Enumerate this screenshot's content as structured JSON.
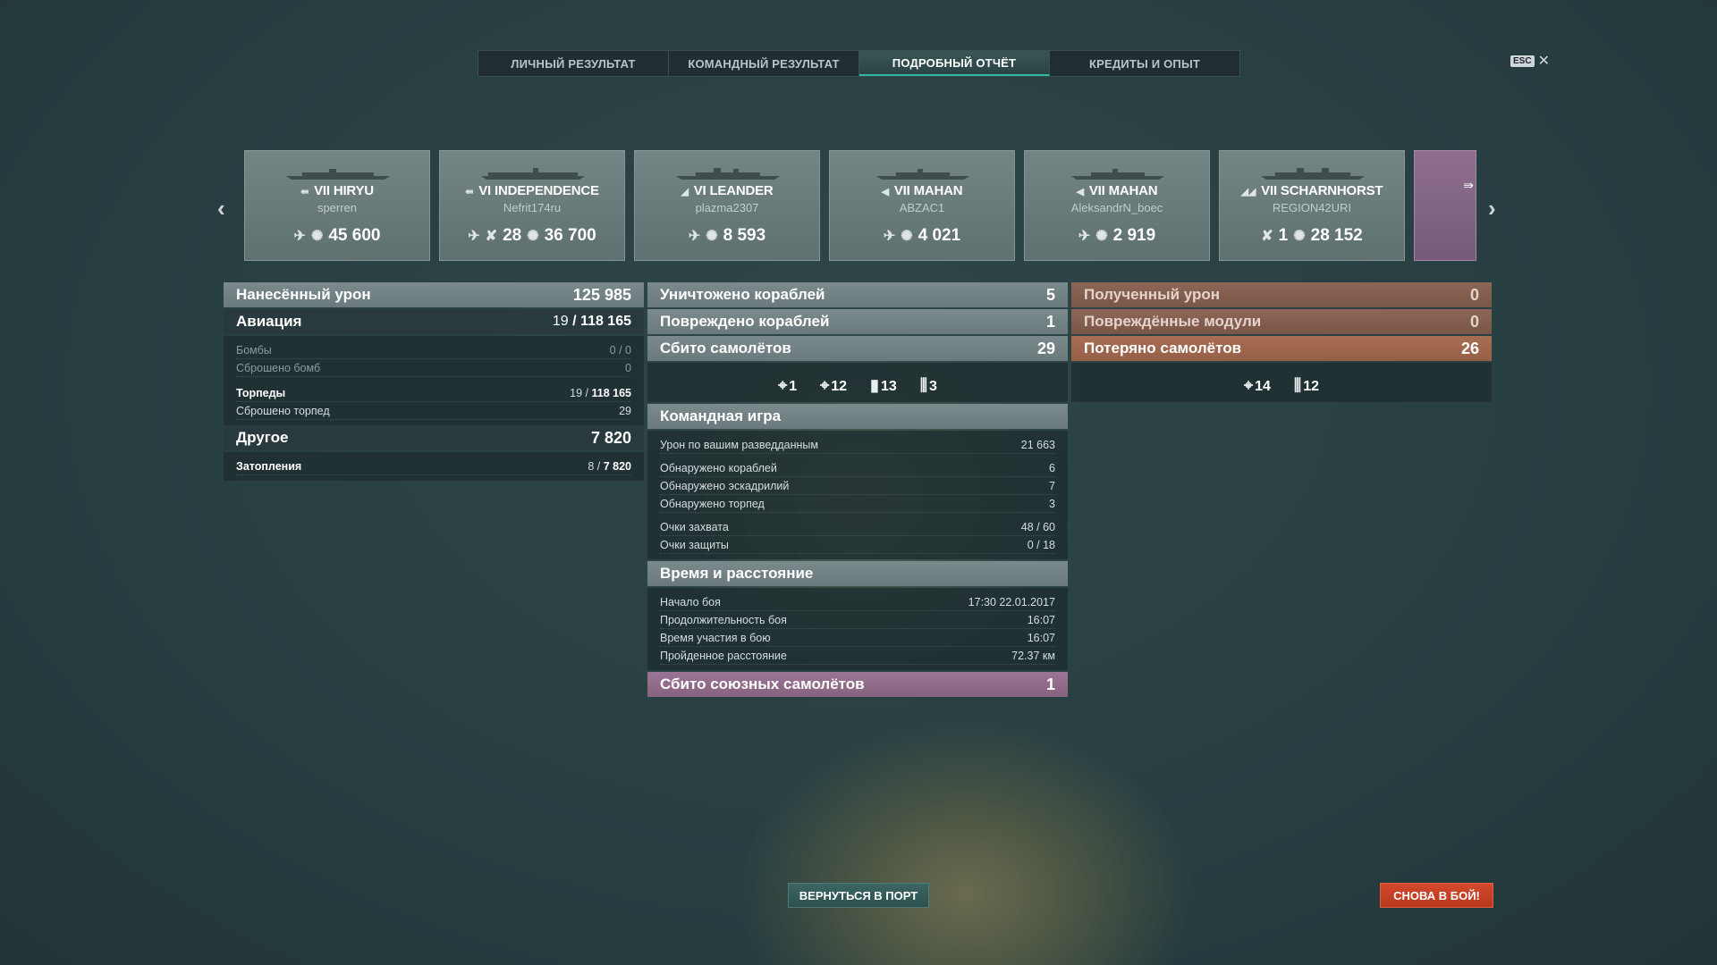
{
  "tabs": [
    {
      "label": "ЛИЧНЫЙ РЕЗУЛЬТАТ",
      "active": false
    },
    {
      "label": "КОМАНДНЫЙ РЕЗУЛЬТАТ",
      "active": false
    },
    {
      "label": "ПОДРОБНЫЙ ОТЧЁТ",
      "active": true
    },
    {
      "label": "КРЕДИТЫ И ОПЫТ",
      "active": false
    }
  ],
  "esc": {
    "key": "ESC",
    "close": "✕"
  },
  "ships": [
    {
      "tier": "VII",
      "name": "HIRYU",
      "player": "sperren",
      "stats": [
        "45 600"
      ]
    },
    {
      "tier": "VI",
      "name": "INDEPENDENCE",
      "player": "Nefrit174ru",
      "stats": [
        "28",
        "36 700"
      ]
    },
    {
      "tier": "VI",
      "name": "LEANDER",
      "player": "plazma2307",
      "stats": [
        "8 593"
      ]
    },
    {
      "tier": "VII",
      "name": "MAHAN",
      "player": "ABZAC1",
      "stats": [
        "4 021"
      ]
    },
    {
      "tier": "VII",
      "name": "MAHAN",
      "player": "AleksandrN_boec",
      "stats": [
        "2 919"
      ]
    },
    {
      "tier": "VII",
      "name": "SCHARNHORST",
      "player": "REGION42URI",
      "stats": [
        "1",
        "28 152"
      ]
    }
  ],
  "left": {
    "damage": {
      "label": "Нанесённый урон",
      "value": "125 985"
    },
    "aviation": {
      "label": "Авиация",
      "value_a": "19",
      "value_b": "118 165"
    },
    "bombs": {
      "label": "Бомбы",
      "value": "0 / 0"
    },
    "bombs_dropped": {
      "label": "Сброшено бомб",
      "value": "0"
    },
    "torpedoes": {
      "label": "Торпеды",
      "value_a": "19",
      "value_b": "118 165"
    },
    "torpedoes_dropped": {
      "label": "Сброшено торпед",
      "value": "29"
    },
    "other": {
      "label": "Другое",
      "value": "7 820"
    },
    "flooding": {
      "label": "Затопления",
      "value_a": "8",
      "value_b": "7 820"
    }
  },
  "middle": {
    "destroyed": {
      "label": "Уничтожено кораблей",
      "value": "5"
    },
    "damaged": {
      "label": "Повреждено кораблей",
      "value": "1"
    },
    "planes_shot": {
      "label": "Сбито самолётов",
      "value": "29"
    },
    "plane_icons": [
      "1",
      "12",
      "13",
      "3"
    ],
    "team": {
      "title": "Командная игра",
      "rows": [
        {
          "label": "Урон по вашим разведданным",
          "value": "21 663"
        },
        {
          "label": "Обнаружено кораблей",
          "value": "6"
        },
        {
          "label": "Обнаружено эскадрилий",
          "value": "7"
        },
        {
          "label": "Обнаружено торпед",
          "value": "3"
        },
        {
          "label": "Очки захвата",
          "value": "48 / 60"
        },
        {
          "label": "Очки защиты",
          "value": "0 / 18"
        }
      ]
    },
    "time": {
      "title": "Время и расстояние",
      "rows": [
        {
          "label": "Начало боя",
          "value": "17:30  22.01.2017"
        },
        {
          "label": "Продолжительность боя",
          "value": "16:07"
        },
        {
          "label": "Время участия в бою",
          "value": "16:07"
        },
        {
          "label": "Пройденное расстояние",
          "value": "72.37 км"
        }
      ]
    },
    "allied_planes": {
      "label": "Сбито союзных самолётов",
      "value": "1"
    }
  },
  "right": {
    "received": {
      "label": "Полученный урон",
      "value": "0"
    },
    "modules": {
      "label": "Повреждённые модули",
      "value": "0"
    },
    "planes_lost": {
      "label": "Потеряно самолётов",
      "value": "26"
    },
    "plane_icons": [
      "14",
      "12"
    ]
  },
  "buttons": {
    "port": "ВЕРНУТЬСЯ В ПОРТ",
    "battle": "СНОВА В БОЙ!"
  }
}
